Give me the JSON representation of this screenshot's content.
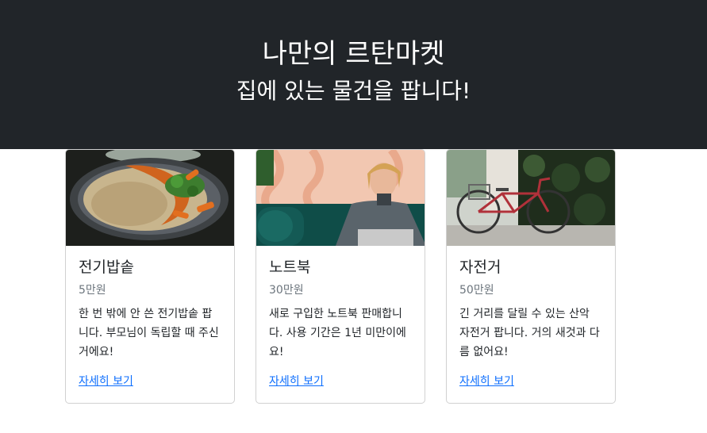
{
  "hero": {
    "title": "나만의 르탄마켓",
    "subtitle": "집에 있는 물건을 팝니다!"
  },
  "colors": {
    "hero_bg": "#212529",
    "link": "#0d6efd",
    "muted": "#6c757d"
  },
  "cards": [
    {
      "image_icon": "rice-cooker-food-photo",
      "title": "전기밥솥",
      "price": "5만원",
      "description": "한 번 밖에 안 쓴 전기밥솥 팝니다. 부모님이 독립할 때 주신 거에요!",
      "link": "자세히 보기"
    },
    {
      "image_icon": "laptop-person-photo",
      "title": "노트북",
      "price": "30만원",
      "description": "새로 구입한 노트북 판매합니다. 사용 기간은 1년 미만이에요!",
      "link": "자세히 보기"
    },
    {
      "image_icon": "bicycle-photo",
      "title": "자전거",
      "price": "50만원",
      "description": "긴 거리를 달릴 수 있는 산악 자전거 팝니다. 거의 새것과 다름 없어요!",
      "link": "자세히 보기"
    }
  ]
}
